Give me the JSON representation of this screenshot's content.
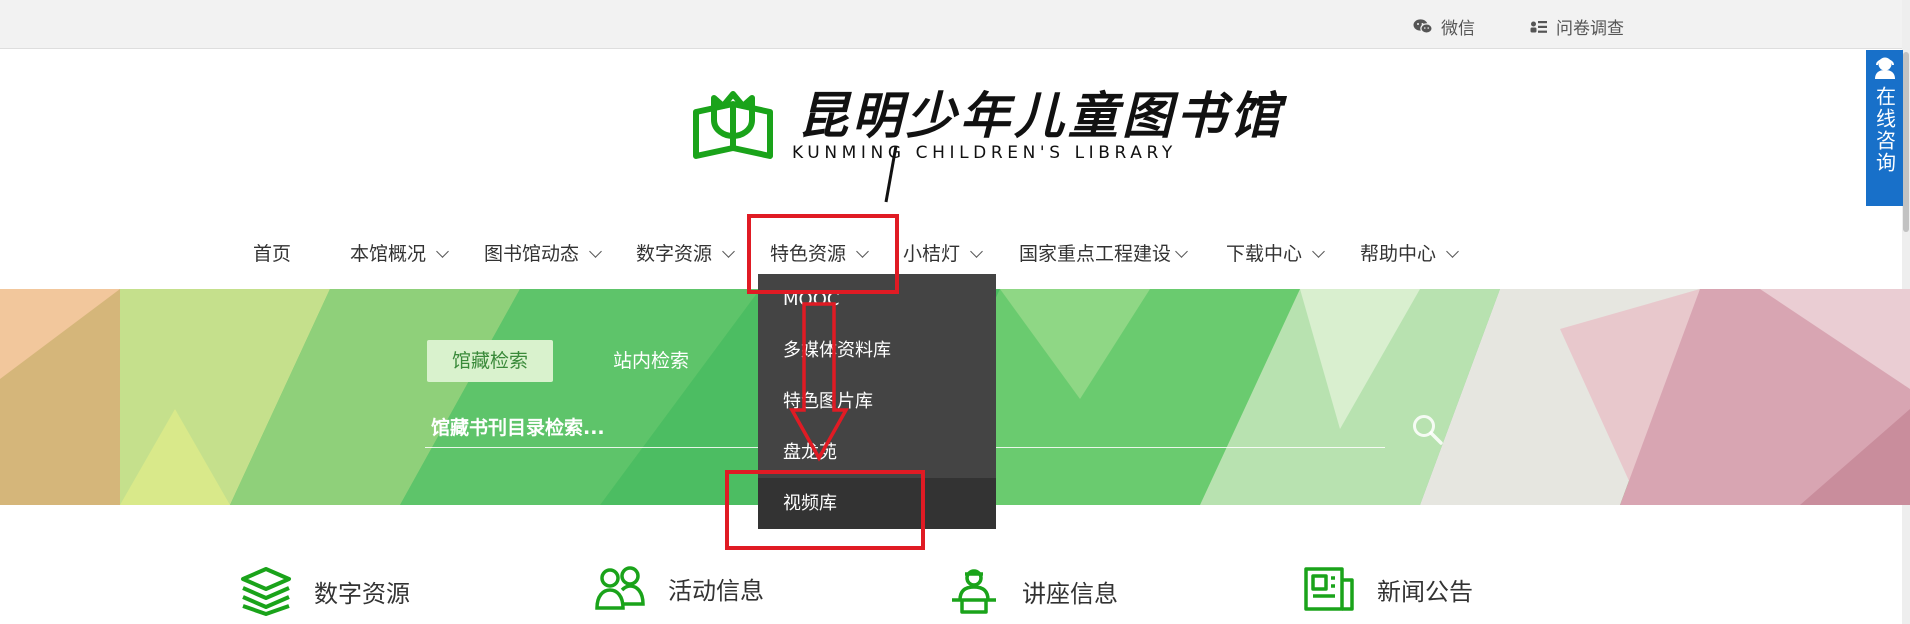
{
  "topbar": {
    "wechat_label": "微信",
    "survey_label": "问卷调查"
  },
  "consult": {
    "label": "在线咨询"
  },
  "logo": {
    "name_cn": "昆明少年儿童图书馆",
    "name_en": "KUNMING CHILDREN'S LIBRARY"
  },
  "nav": {
    "items": [
      {
        "label": "首页"
      },
      {
        "label": "本馆概况"
      },
      {
        "label": "图书馆动态"
      },
      {
        "label": "数字资源"
      },
      {
        "label": "特色资源"
      },
      {
        "label": "小桔灯"
      },
      {
        "label": "国家重点工程建设"
      },
      {
        "label": "下载中心"
      },
      {
        "label": "帮助中心"
      }
    ]
  },
  "search": {
    "tabs": [
      {
        "label": "馆藏检索",
        "active": true
      },
      {
        "label": "站内检索",
        "active": false
      }
    ],
    "placeholder": "馆藏书刊目录检索..."
  },
  "dropdown": {
    "items": [
      {
        "label": "MOOC"
      },
      {
        "label": "多媒体资料库"
      },
      {
        "label": "特色图片库"
      },
      {
        "label": "盘龙苑"
      },
      {
        "label": "视频库"
      }
    ]
  },
  "categories": [
    {
      "label": "数字资源",
      "icon": "layers-icon"
    },
    {
      "label": "活动信息",
      "icon": "people-icon"
    },
    {
      "label": "讲座信息",
      "icon": "lecturer-icon"
    },
    {
      "label": "新闻公告",
      "icon": "newspaper-icon"
    }
  ],
  "colors": {
    "brand_green": "#1aa31a",
    "consult_blue": "#1870c9",
    "dropdown_bg": "#444444",
    "annotation_red": "#e01b24"
  }
}
